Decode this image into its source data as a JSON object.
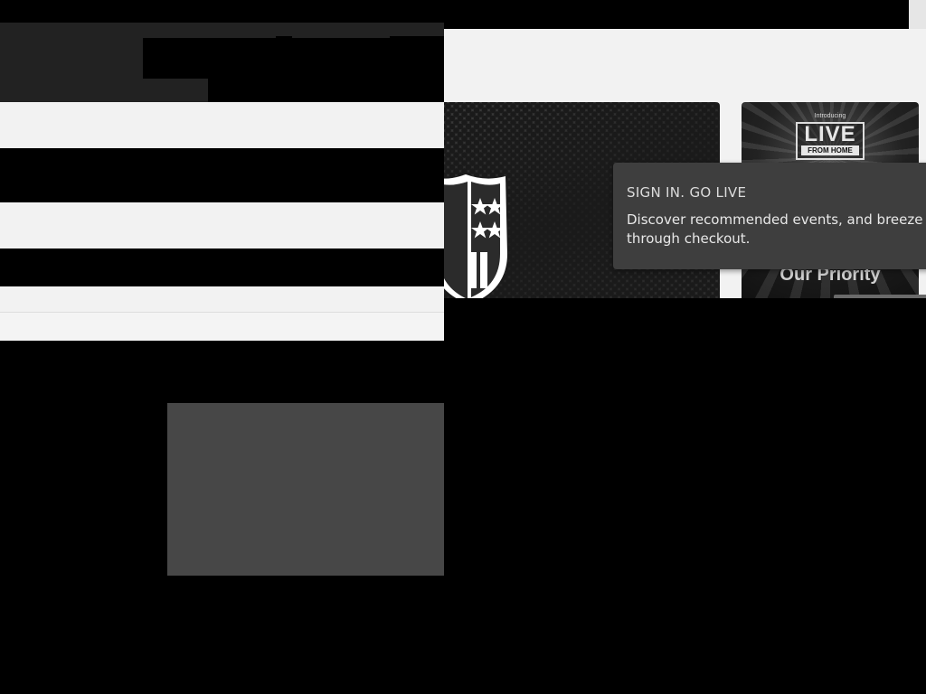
{
  "tooltip": {
    "title": "SIGN IN. GO LIVE",
    "body": "Discover recommended events, and breeze through checkout."
  },
  "cards": {
    "live_from_home": {
      "intro": "Introducing",
      "word": "LIVE",
      "sub": "FROM HOME",
      "caption": "Our Priority"
    },
    "nfl": {
      "icon": "nfl-shield-icon"
    }
  },
  "colors": {
    "page_background": "#000000",
    "light_panel": "#f2f2f2",
    "tooltip_background": "#3e3e3e",
    "redaction_dark": "#222222"
  }
}
